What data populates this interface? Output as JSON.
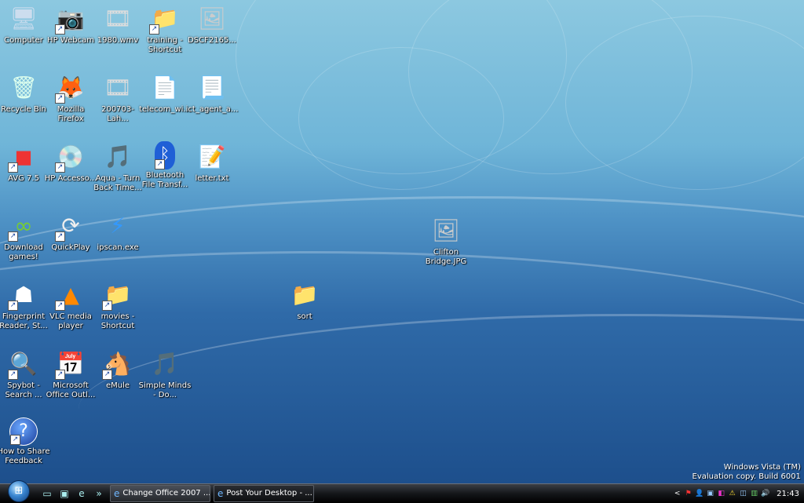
{
  "desktop": {
    "icons": [
      {
        "label": "Computer",
        "icon": "computer-icon",
        "glyph": "🖥",
        "shortcut": false
      },
      {
        "label": "HP Webcam",
        "icon": "webcam-icon",
        "glyph": "📷",
        "shortcut": true
      },
      {
        "label": "1980.wmv",
        "icon": "video-file-icon",
        "glyph": "🎞",
        "shortcut": false
      },
      {
        "label": "training - Shortcut",
        "icon": "folder-icon",
        "glyph": "📁",
        "shortcut": true
      },
      {
        "label": "DSCF2165...",
        "icon": "photo-file-icon",
        "glyph": "🖼",
        "shortcut": false
      },
      {
        "label": "Recycle Bin",
        "icon": "recycle-bin-icon",
        "glyph": "🗑",
        "shortcut": false
      },
      {
        "label": "Mozilla Firefox",
        "icon": "firefox-icon",
        "glyph": "🦊",
        "shortcut": true
      },
      {
        "label": "200703-Lah...",
        "icon": "video-file-icon",
        "glyph": "🎞",
        "shortcut": false
      },
      {
        "label": "telecom_wi...",
        "icon": "pdf-file-icon",
        "glyph": "📄",
        "shortcut": false
      },
      {
        "label": "ict_agent_a...",
        "icon": "document-file-icon",
        "glyph": "📃",
        "shortcut": false
      },
      {
        "label": "AVG 7.5",
        "icon": "avg-icon",
        "glyph": "◼",
        "shortcut": true
      },
      {
        "label": "HP Accesso...",
        "icon": "hp-accessories-icon",
        "glyph": "💿",
        "shortcut": true
      },
      {
        "label": "Aqua - Turn Back Time...",
        "icon": "mp3-file-icon",
        "glyph": "🎵",
        "shortcut": false
      },
      {
        "label": "Bluetooth File Transf...",
        "icon": "bluetooth-icon",
        "glyph": "ᛒ",
        "shortcut": true
      },
      {
        "label": "letter.txt",
        "icon": "text-file-icon",
        "glyph": "📝",
        "shortcut": false
      },
      {
        "label": "Download games!",
        "icon": "games-icon",
        "glyph": "∞",
        "shortcut": true
      },
      {
        "label": "QuickPlay",
        "icon": "quickplay-icon",
        "glyph": "⟳",
        "shortcut": true
      },
      {
        "label": "ipscan.exe",
        "icon": "ipscan-icon",
        "glyph": "⚡",
        "shortcut": false
      },
      {
        "label": "Fingerprint Reader, St...",
        "icon": "fingerprint-icon",
        "glyph": "☗",
        "shortcut": true
      },
      {
        "label": "VLC media player",
        "icon": "vlc-icon",
        "glyph": "▲",
        "shortcut": true
      },
      {
        "label": "movies - Shortcut",
        "icon": "folder-icon",
        "glyph": "📁",
        "shortcut": true
      },
      {
        "label": "Spybot - Search ...",
        "icon": "spybot-icon",
        "glyph": "🔍",
        "shortcut": true
      },
      {
        "label": "Microsoft Office Outl...",
        "icon": "outlook-icon",
        "glyph": "📅",
        "shortcut": true
      },
      {
        "label": "eMule",
        "icon": "emule-icon",
        "glyph": "🐴",
        "shortcut": true
      },
      {
        "label": "Simple Minds - Do...",
        "icon": "mp3-file-icon",
        "glyph": "🎵",
        "shortcut": false
      },
      {
        "label": "How to Share Feedback",
        "icon": "help-icon",
        "glyph": "?",
        "shortcut": true
      },
      {
        "label": "Clifton Bridge.JPG",
        "icon": "photo-file-icon",
        "glyph": "🖼",
        "shortcut": false
      },
      {
        "label": "sort",
        "icon": "folder-icon",
        "glyph": "📁",
        "shortcut": false
      }
    ],
    "watermark_line1": "Windows Vista (TM)",
    "watermark_line2": "Evaluation copy. Build 6001"
  },
  "taskbar": {
    "start_label": "Start",
    "quick_launch": [
      {
        "name": "show-desktop-icon",
        "glyph": "▭"
      },
      {
        "name": "switch-windows-icon",
        "glyph": "▣"
      },
      {
        "name": "internet-explorer-icon",
        "glyph": "e"
      }
    ],
    "overflow_glyph": "»",
    "tasks": [
      {
        "label": "Change Office 2007 ...",
        "active": false
      },
      {
        "label": "Post Your Desktop - ...",
        "active": true
      }
    ],
    "tray_arrow": "<",
    "tray_icons": [
      "⚑",
      "👤",
      "▣",
      "◧",
      "⚠",
      "◫",
      "▥",
      "🔊"
    ],
    "clock": "21:43"
  },
  "colors": {
    "desktop_top": "#8cc8e0",
    "desktop_bottom": "#1d4f8c",
    "taskbar": "#141619"
  }
}
